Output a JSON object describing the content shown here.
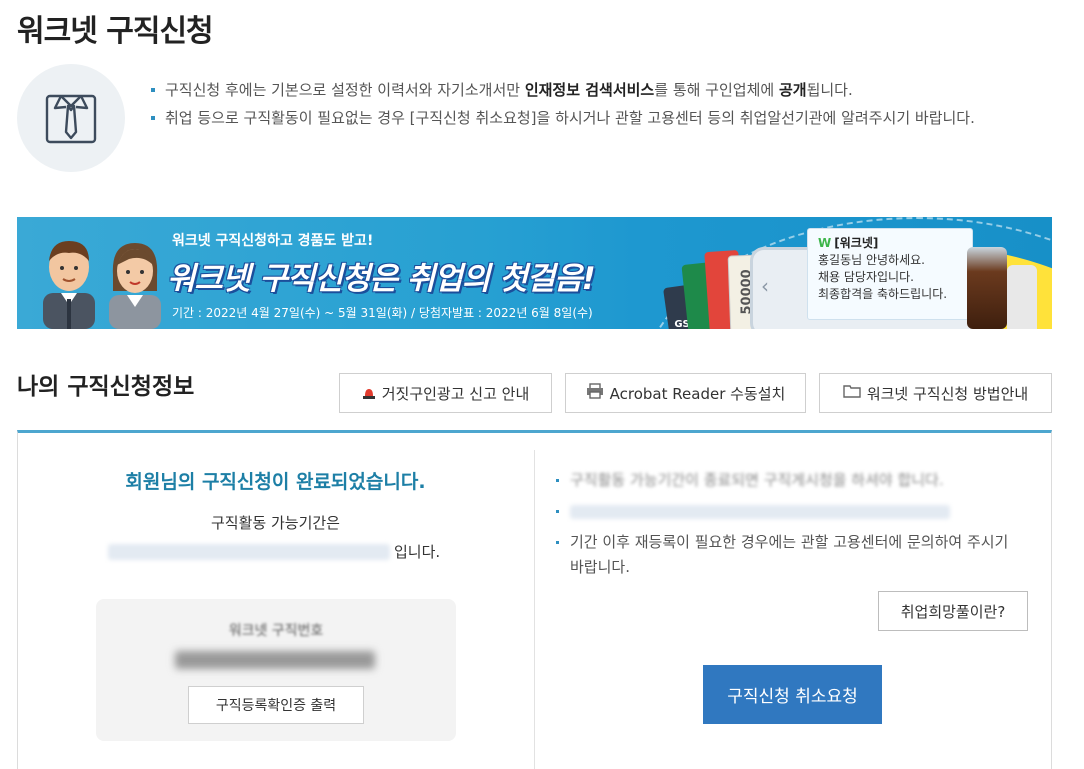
{
  "page": {
    "title": "워크넷 구직신청"
  },
  "intro": {
    "icon": "shirt-tie-icon",
    "item1": {
      "before": "구직신청 후에는 기본으로 설정한 이력서와 자기소개서만 ",
      "strong1": "인재정보 검색서비스",
      "middle": "를 통해 구인업체에 ",
      "strong2": "공개",
      "after": "됩니다."
    },
    "item2": "취업 등으로 구직활동이 필요없는 경우 [구직신청 취소요청]을 하시거나 관할 고용센터 등의 취업알선기관에 알려주시기 바랍니다."
  },
  "banner": {
    "sub": "워크넷 구직신청하고 경품도 받고!",
    "main": "워크넷 구직신청은 취업의 첫걸음!",
    "period": "기간 : 2022년 4월 27일(수) ~ 5월 31일(화) / 당첨자발표 : 2022년 6월 8일(수)",
    "card_brand": "GS25",
    "card_amount": "50000",
    "message": {
      "logo_mark": "W",
      "logo": "[워크넷]",
      "line1": "홍길동님 안녕하세요.",
      "line2": "채용 담당자입니다.",
      "line3": "최종합격을 축하드립니다."
    }
  },
  "my_info": {
    "title": "나의 구직신청정보",
    "buttons": {
      "fake_ad": "거짓구인광고 신고 안내",
      "acrobat": "Acrobat Reader 수동설치",
      "guide": "워크넷 구직신청 방법안내"
    },
    "left": {
      "done_message": "회원님의 구직신청이 완료되었습니다.",
      "period_label": "구직활동 가능기간은",
      "period_suffix": "입니다.",
      "card_label": "워크넷 구직번호",
      "print_button": "구직등록확인증 출력"
    },
    "right": {
      "notice1": "구직활동 가능기간이 종료되면 구직게시청을 하셔야 합니다.",
      "notice3": "기간 이후 재등록이 필요한 경우에는 관할 고용센터에 문의하여 주시기 바랍니다.",
      "hope_button": "취업희망풀이란?",
      "cancel_button": "구직신청 취소요청"
    }
  },
  "colors": {
    "accent": "#1d7fa6",
    "primary_button": "#3078c0",
    "section_line": "#4da6cf"
  }
}
